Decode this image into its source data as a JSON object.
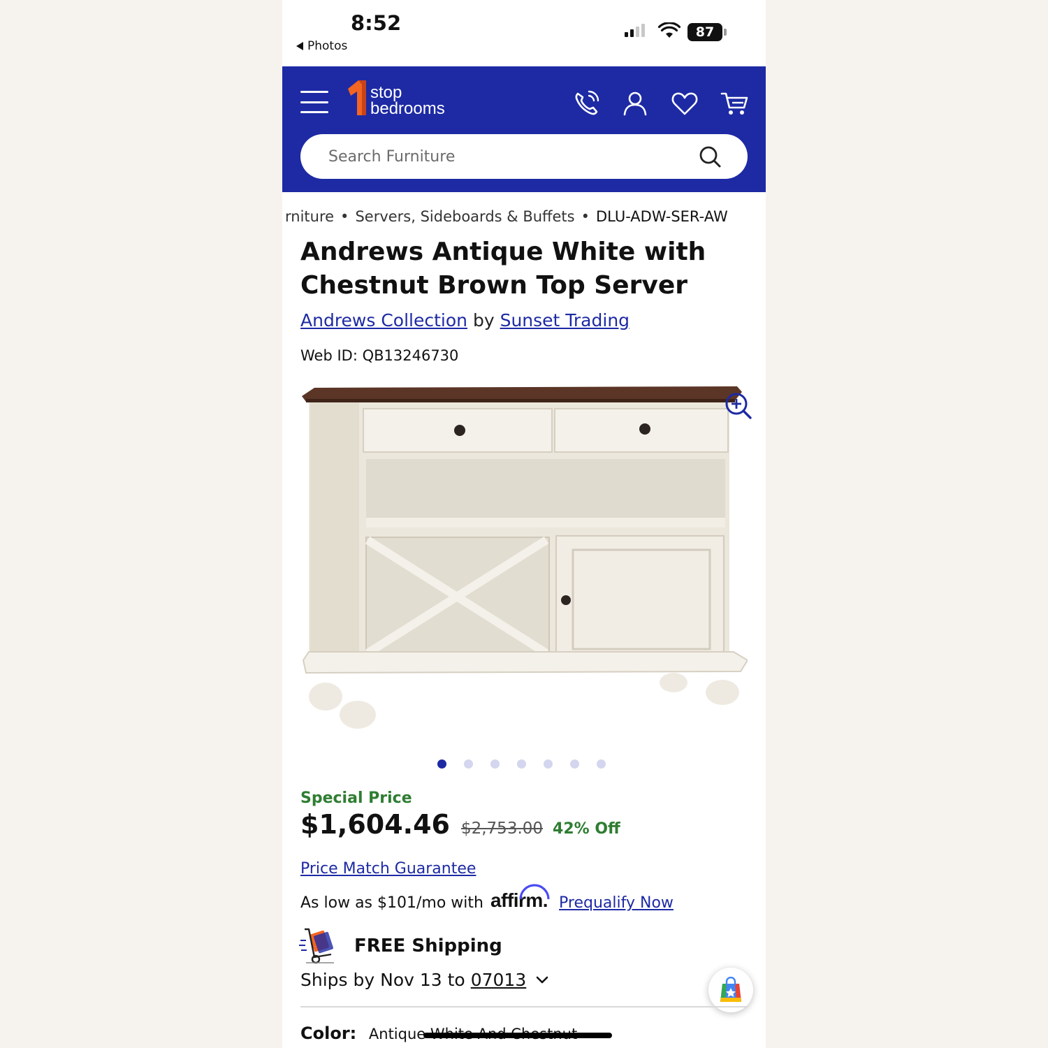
{
  "status_bar": {
    "time": "8:52",
    "back_label": "Photos",
    "battery": "87"
  },
  "header": {
    "brand_number": "1",
    "brand_line1": "stop",
    "brand_line2": "bedrooms",
    "brand_color": "#1d2aa4",
    "logo_accent": "#f26522",
    "icons": [
      "menu-icon",
      "phone-icon",
      "account-icon",
      "heart-icon",
      "cart-icon"
    ],
    "search_placeholder": "Search Furniture"
  },
  "breadcrumb": {
    "items": [
      "rniture",
      "Servers, Sideboards & Buffets"
    ],
    "current": "DLU-ADW-SER-AW"
  },
  "product": {
    "title": "Andrews Antique White with Chestnut Brown Top Server",
    "collection": "Andrews Collection",
    "by": "by",
    "brand": "Sunset Trading",
    "web_id": "Web ID: QB13246730",
    "image_count": 7,
    "active_image": 1
  },
  "pricing": {
    "label": "Special Price",
    "current": "$1,604.46",
    "original": "$2,753.00",
    "discount": "42% Off",
    "price_match": "Price Match Guarantee",
    "financing_text": "As low as $101/mo with",
    "financing_brand": "affirm",
    "financing_suffix": ".",
    "prequalify": "Prequalify Now"
  },
  "shipping": {
    "title": "FREE Shipping",
    "ships_by": "Ships by Nov 13 to",
    "zip": "07013"
  },
  "color": {
    "label": "Color:",
    "value": "Antique White And Chestnut"
  }
}
